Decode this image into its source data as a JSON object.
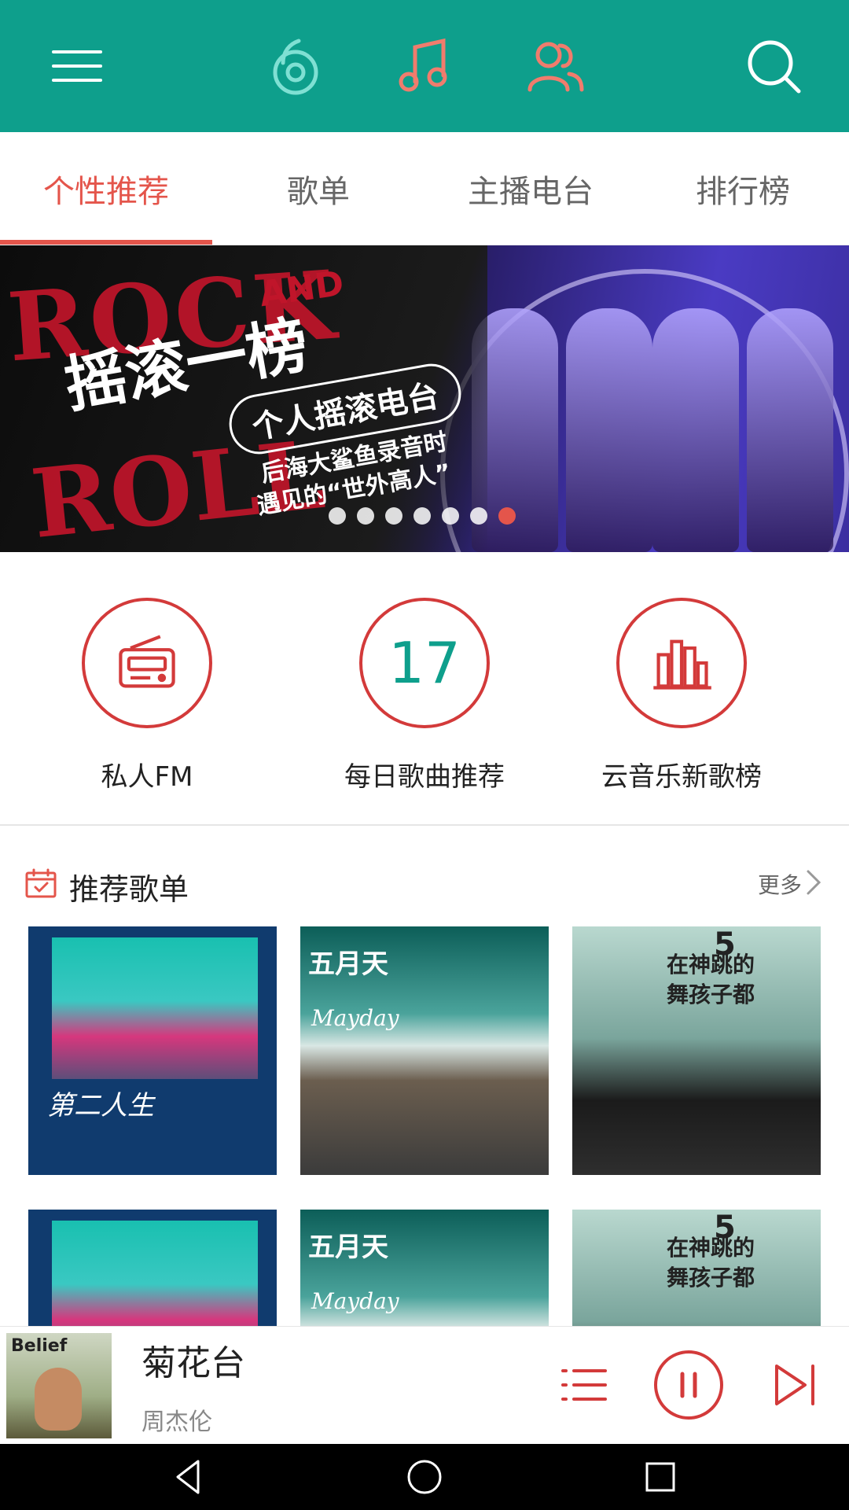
{
  "tabs": [
    {
      "label": "个性推荐",
      "active": true
    },
    {
      "label": "歌单",
      "active": false
    },
    {
      "label": "主播电台",
      "active": false
    },
    {
      "label": "排行榜",
      "active": false
    }
  ],
  "banner": {
    "rock": "ROCK",
    "and": "AND",
    "roll": "ROLL",
    "title": "摇滚一榜",
    "pill": "个人摇滚电台",
    "line1": "后海大鲨鱼录音时",
    "line2": "遇见的“世外高人”",
    "pages": 7,
    "current_page": 7
  },
  "quick_actions": [
    {
      "label": "私人FM",
      "icon": "radio-icon"
    },
    {
      "label": "每日歌曲推荐",
      "icon_text": "17"
    },
    {
      "label": "云音乐新歌榜",
      "icon": "bar-chart-icon"
    }
  ],
  "section": {
    "title": "推荐歌单",
    "more": "更多"
  },
  "covers": {
    "a_text": "第二人生",
    "b_text": "五月天",
    "b_sub": "Mayday",
    "c_text": "在神跳的舞孩子都",
    "c_num": "5"
  },
  "player": {
    "title": "菊花台",
    "artist": "周杰伦",
    "art_text": "Belief"
  },
  "colors": {
    "primary": "#0e9f8c",
    "accent": "#e4554b",
    "icon_red": "#d33a3a"
  }
}
